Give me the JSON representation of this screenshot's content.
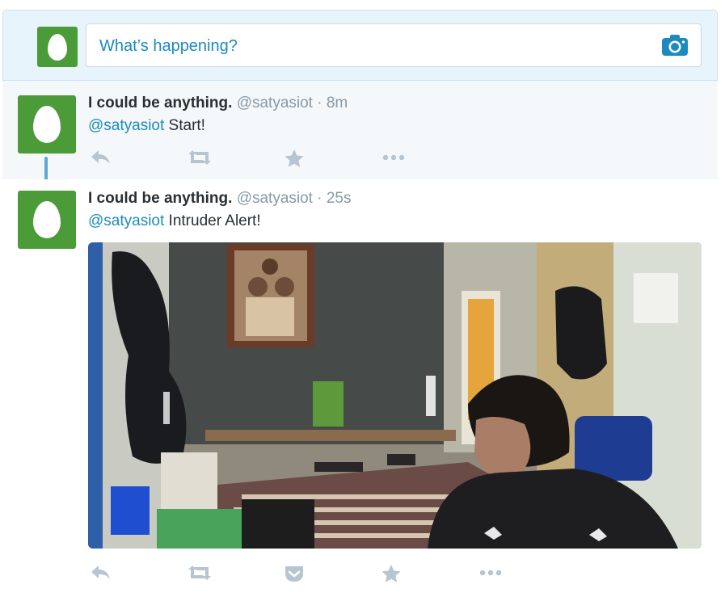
{
  "compose": {
    "placeholder": "What’s happening?"
  },
  "tweets": [
    {
      "fullname": "I could be anything.",
      "username": "@satyasiot",
      "separator": "·",
      "time": "8m",
      "mention": "@satyasiot",
      "text": " Start!"
    },
    {
      "fullname": "I could be anything.",
      "username": "@satyasiot",
      "separator": "·",
      "time": "25s",
      "mention": "@satyasiot",
      "text": " Intruder Alert!",
      "has_photo": true
    }
  ],
  "colors": {
    "avatar_green": "#4b9b38",
    "link_blue": "#1b8ac0",
    "icon_gray": "#b6c5d0",
    "compose_bg": "#e8f4fb",
    "thread_line": "#5ba9d2"
  },
  "icons": {
    "reply": "reply-icon",
    "retweet": "retweet-icon",
    "favorite": "star-icon",
    "more": "more-dots-icon",
    "pocket": "pocket-icon",
    "camera": "camera-icon"
  }
}
